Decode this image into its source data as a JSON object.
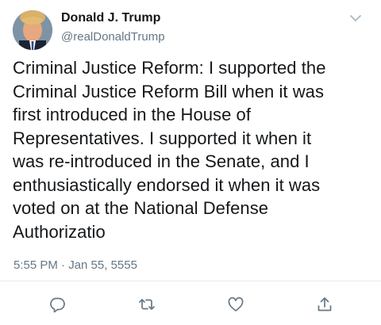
{
  "tweet": {
    "display_name": "Donald J. Trump",
    "handle": "@realDonaldTrump",
    "text_lines": [
      "Criminal Justice Reform: I supported the",
      "Criminal Justice Reform Bill when it was",
      "first introduced in the House of",
      "Representatives. I supported it when it",
      "was re-introduced in the Senate, and I",
      "enthusiastically endorsed it when it was",
      "voted on at the National Defense",
      "Authorizatio"
    ],
    "timestamp": "5:55 PM · Jan 55, 5555"
  },
  "icons": {
    "menu": "chevron-down-icon",
    "reply": "reply-icon",
    "retweet": "retweet-icon",
    "like": "heart-icon",
    "share": "share-icon"
  },
  "colors": {
    "text": "#14171a",
    "secondary": "#657786",
    "icon": "#657786",
    "divider": "#e6ecf0"
  }
}
